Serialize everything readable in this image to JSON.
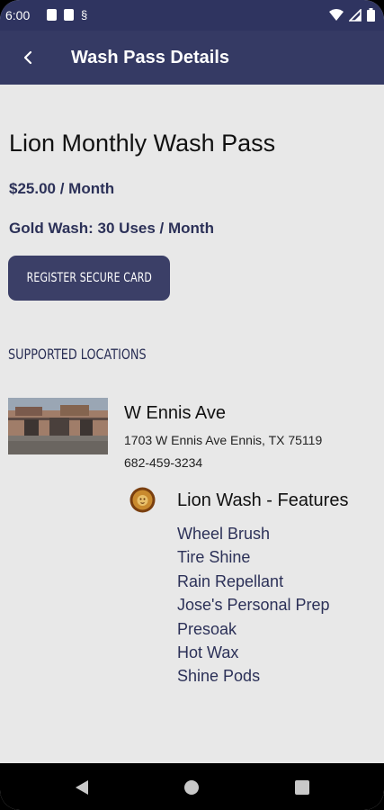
{
  "status_bar": {
    "time": "6:00"
  },
  "app_bar": {
    "title": "Wash Pass Details"
  },
  "plan": {
    "title": "Lion Monthly Wash Pass",
    "price": "$25.00 / Month",
    "uses": "Gold Wash: 30 Uses / Month",
    "register_button": "REGISTER SECURE CARD"
  },
  "locations_section": {
    "label": "SUPPORTED LOCATIONS"
  },
  "location": {
    "name": "W Ennis Ave",
    "address": "1703 W Ennis Ave Ennis, TX 75119",
    "phone": "682-459-3234",
    "features_title": "Lion Wash - Features",
    "features": [
      "Wheel Brush",
      "Tire Shine",
      "Rain Repellant",
      "Jose's Personal Prep",
      "Presoak",
      "Hot Wax",
      "Shine Pods"
    ]
  },
  "icons": {
    "back": "arrow-left-icon",
    "wifi": "wifi-icon",
    "signal": "signal-icon",
    "battery": "battery-icon",
    "lion": "lion-logo-icon",
    "nav_back": "nav-back-icon",
    "nav_home": "nav-home-icon",
    "nav_recents": "nav-recents-icon"
  },
  "colors": {
    "header": "#353a64",
    "accent_text": "#2c3158",
    "button": "#3b3f67",
    "background": "#e8e8e8"
  }
}
